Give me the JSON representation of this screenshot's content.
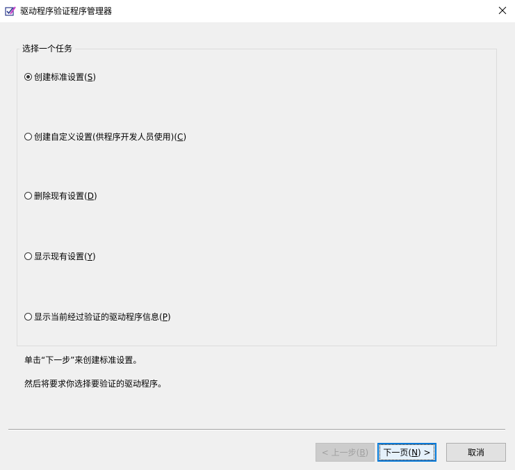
{
  "window": {
    "title": "驱动程序验证程序管理器",
    "app_icon": "checklist-pen-icon",
    "close_icon": "close-icon"
  },
  "group": {
    "label": "选择一个任务"
  },
  "options": [
    {
      "text": "创建标准设置(",
      "key": "S",
      "suffix": ")",
      "checked": true
    },
    {
      "text": "创建自定义设置(供程序开发人员使用)(",
      "key": "C",
      "suffix": ")",
      "checked": false
    },
    {
      "text": "删除现有设置(",
      "key": "D",
      "suffix": ")",
      "checked": false
    },
    {
      "text": "显示现有设置(",
      "key": "Y",
      "suffix": ")",
      "checked": false
    },
    {
      "text": "显示当前经过验证的驱动程序信息(",
      "key": "P",
      "suffix": ")",
      "checked": false
    }
  ],
  "description": {
    "line1": "单击“下一步”来创建标准设置。",
    "line2": "然后将要求你选择要验证的驱动程序。"
  },
  "buttons": {
    "back": {
      "pre": "< 上一步(",
      "key": "B",
      "post": ")"
    },
    "next": {
      "pre": "下一页(",
      "key": "N",
      "post": ") >"
    },
    "cancel": {
      "label": "取消"
    }
  },
  "colors": {
    "accent": "#0078d7",
    "dialog_bg": "#f0f0f0"
  }
}
